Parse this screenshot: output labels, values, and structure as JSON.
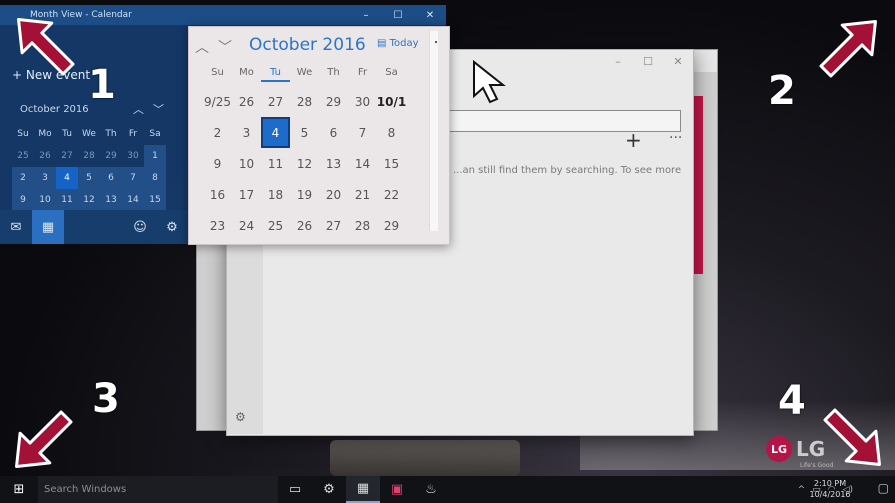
{
  "calendar_window": {
    "title": "Month View - Calendar",
    "new_event_label": "New event",
    "mini_month_label": "October 2016",
    "mini_weekdays": [
      "Su",
      "Mo",
      "Tu",
      "We",
      "Th",
      "Fr",
      "Sa"
    ],
    "mini_days": [
      "25",
      "26",
      "27",
      "28",
      "29",
      "30",
      "1",
      "2",
      "3",
      "4",
      "5",
      "6",
      "7",
      "8",
      "9",
      "10",
      "11",
      "12",
      "13",
      "14",
      "15"
    ],
    "mini_selected_day": "4"
  },
  "flyout": {
    "month_label": "October 2016",
    "today_label": "Today",
    "weekdays": [
      "Su",
      "Mo",
      "Tu",
      "We",
      "Th",
      "Fr",
      "Sa"
    ],
    "days": [
      "9/25",
      "26",
      "27",
      "28",
      "29",
      "30",
      "10/1",
      "2",
      "3",
      "4",
      "5",
      "6",
      "7",
      "8",
      "9",
      "10",
      "11",
      "12",
      "13",
      "14",
      "15",
      "16",
      "17",
      "18",
      "19",
      "20",
      "21",
      "22",
      "23",
      "24",
      "25",
      "26",
      "27",
      "28",
      "29"
    ],
    "selected_day": "4",
    "current_weekday": "Tu"
  },
  "back_window": {
    "hint_text": "...an still find them by searching. To see more"
  },
  "annotations": {
    "labels": [
      "1",
      "2",
      "3",
      "4"
    ]
  },
  "taskbar": {
    "search_placeholder": "Search Windows",
    "time": "2:10 PM",
    "date": "10/4/2016"
  },
  "branding": {
    "logo_mark": "LG",
    "logo_text": "LG",
    "tagline": "Life's Good"
  },
  "colors": {
    "arrow": "#a31236",
    "accent": "#2b74c7",
    "selection": "#1e6bc9",
    "brand": "#b51546"
  }
}
